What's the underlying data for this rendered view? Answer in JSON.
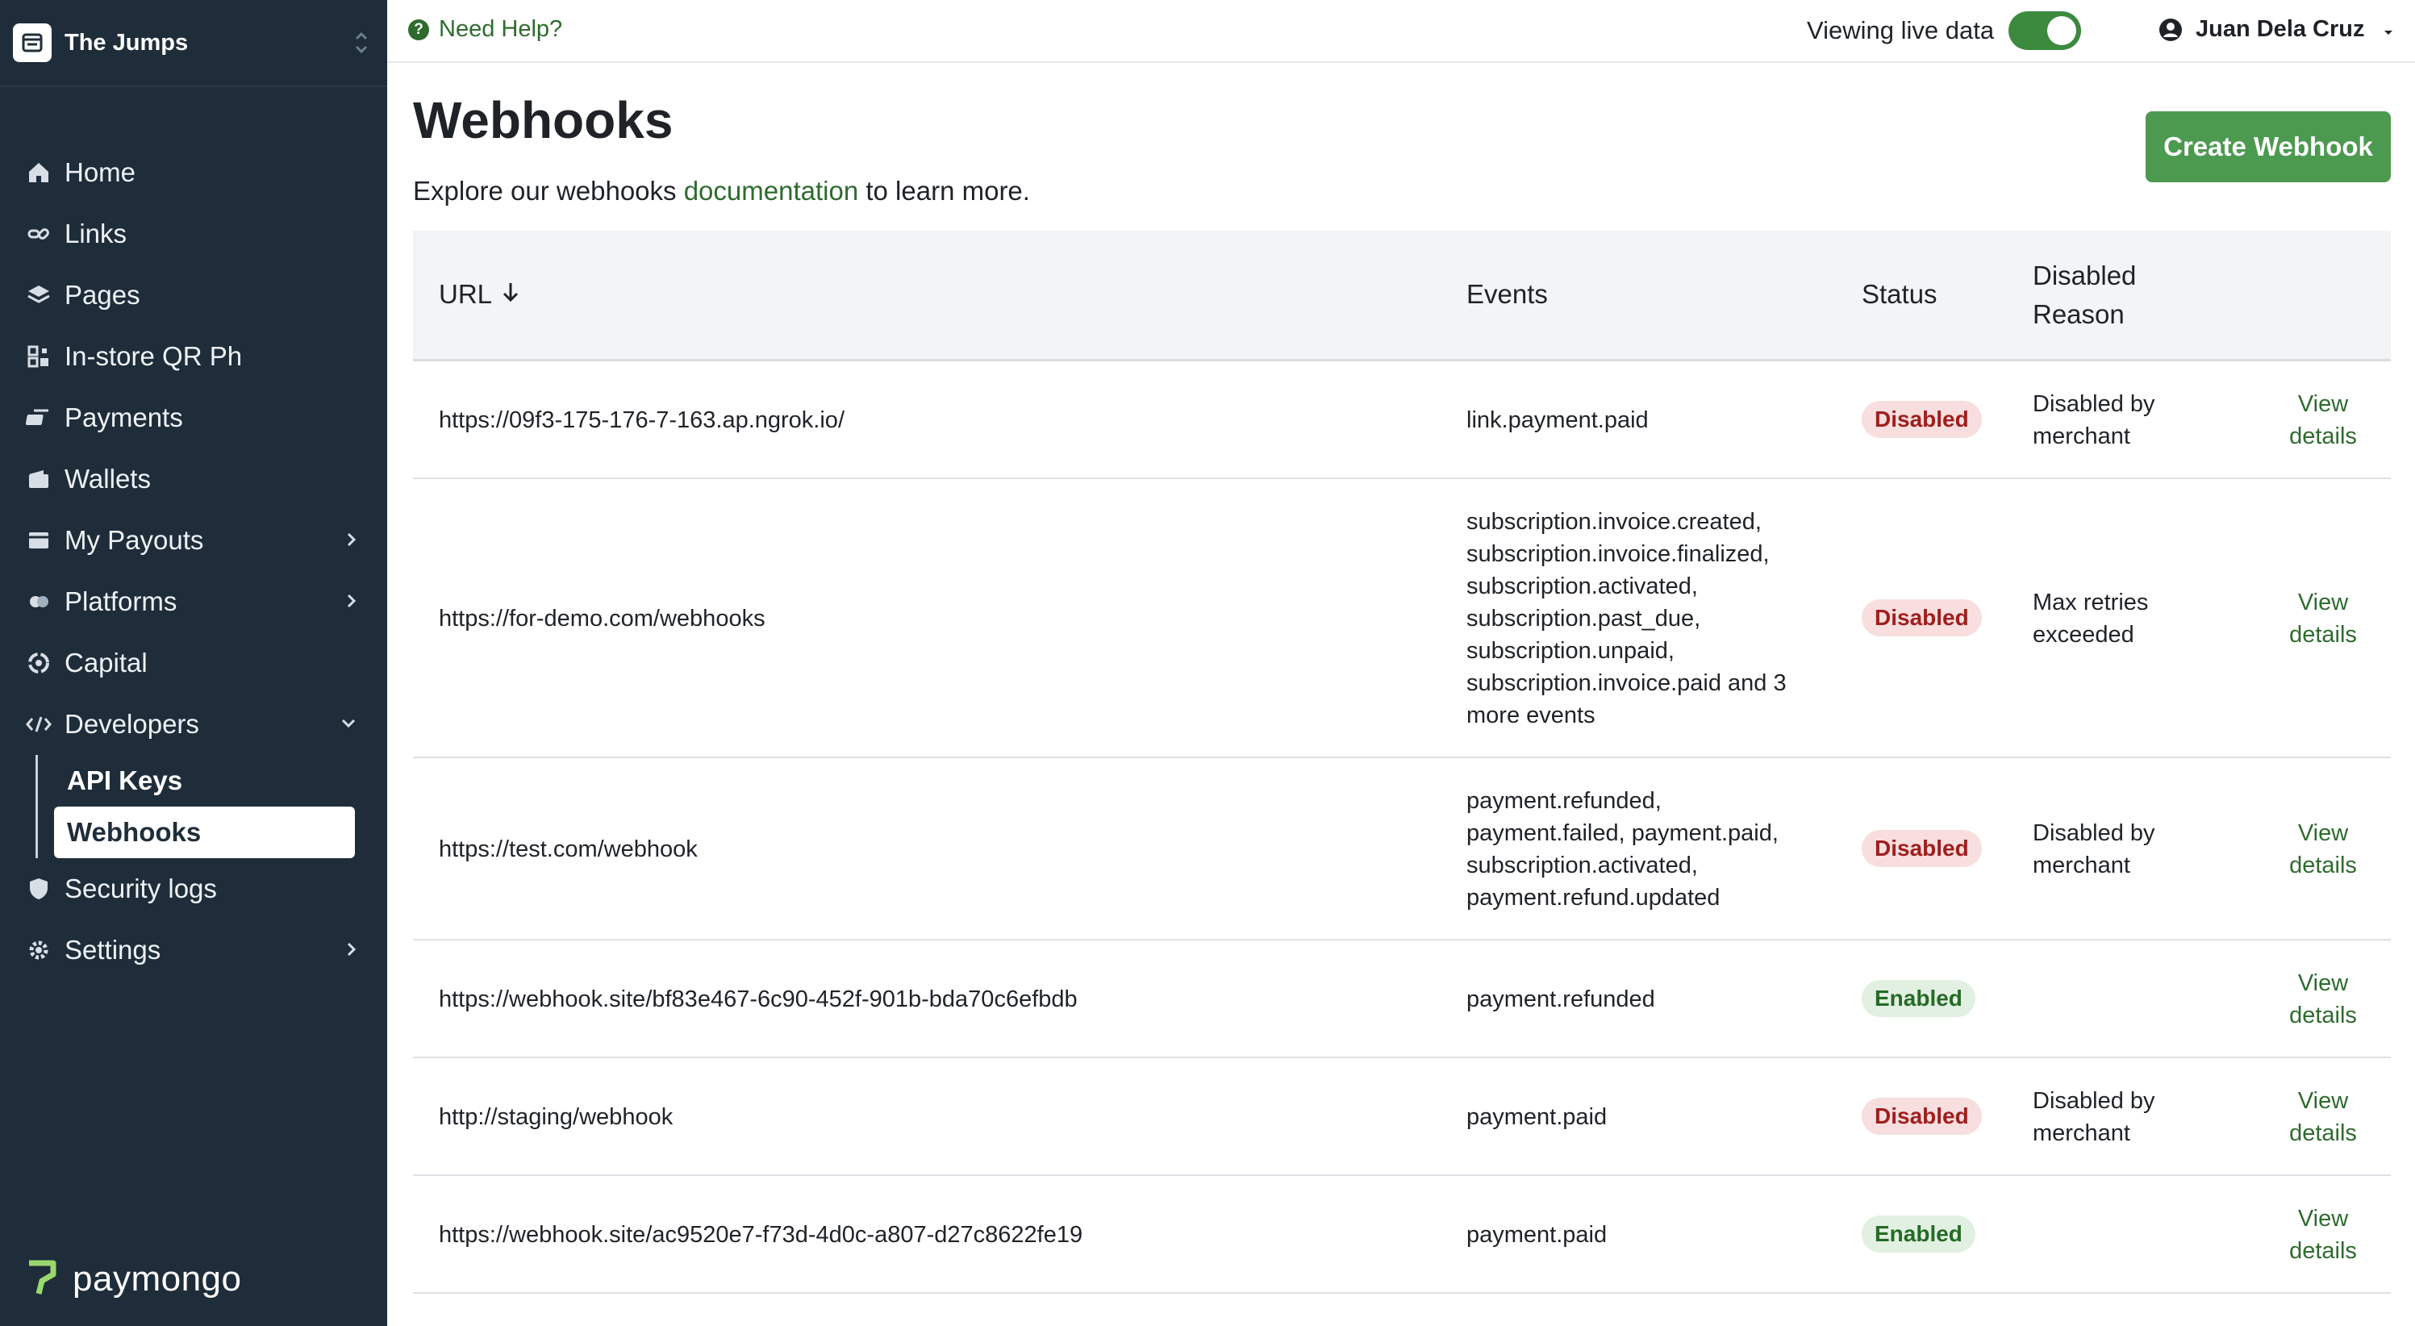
{
  "org": {
    "name": "The Jumps"
  },
  "sidebar": {
    "items": [
      {
        "label": "Home",
        "icon": "home-icon"
      },
      {
        "label": "Links",
        "icon": "links-icon"
      },
      {
        "label": "Pages",
        "icon": "pages-icon"
      },
      {
        "label": "In-store QR Ph",
        "icon": "qr-icon"
      },
      {
        "label": "Payments",
        "icon": "payments-icon"
      },
      {
        "label": "Wallets",
        "icon": "wallet-icon"
      },
      {
        "label": "My Payouts",
        "icon": "payouts-icon"
      },
      {
        "label": "Platforms",
        "icon": "platforms-icon"
      },
      {
        "label": "Capital",
        "icon": "capital-icon"
      },
      {
        "label": "Developers",
        "icon": "code-icon"
      },
      {
        "label": "Security logs",
        "icon": "shield-icon"
      },
      {
        "label": "Settings",
        "icon": "gear-icon"
      }
    ],
    "developers_sub": [
      {
        "label": "API Keys"
      },
      {
        "label": "Webhooks",
        "active": true
      }
    ]
  },
  "brand": {
    "name": "paymongo"
  },
  "topbar": {
    "help_label": "Need Help?",
    "live_label": "Viewing live data",
    "live_on": true,
    "user_name": "Juan Dela Cruz"
  },
  "page": {
    "title": "Webhooks",
    "intro_before": "Explore our webhooks",
    "intro_link": "documentation",
    "intro_after": "to learn more.",
    "create_label": "Create Webhook"
  },
  "table": {
    "columns": {
      "url": "URL",
      "events": "Events",
      "status": "Status",
      "reason_line1": "Disabled",
      "reason_line2": "Reason"
    },
    "rows": [
      {
        "url": "https://09f3-175-176-7-163.ap.ngrok.io/",
        "events": [
          "link.payment.paid"
        ],
        "status": "Disabled",
        "reason": [
          "Disabled by",
          "merchant"
        ],
        "view": [
          "View",
          "details"
        ]
      },
      {
        "url": "https://for-demo.com/webhooks",
        "events": [
          "subscription.invoice.created,",
          "subscription.invoice.finalized,",
          "subscription.activated,",
          "subscription.past_due,",
          "subscription.unpaid,",
          "subscription.invoice.paid and 3",
          "more events"
        ],
        "status": "Disabled",
        "reason": [
          "Max retries",
          "exceeded"
        ],
        "view": [
          "View",
          "details"
        ]
      },
      {
        "url": "https://test.com/webhook",
        "events": [
          "payment.refunded,",
          "payment.failed, payment.paid,",
          "subscription.activated,",
          "payment.refund.updated"
        ],
        "status": "Disabled",
        "reason": [
          "Disabled by",
          "merchant"
        ],
        "view": [
          "View",
          "details"
        ]
      },
      {
        "url": "https://webhook.site/bf83e467-6c90-452f-901b-bda70c6efbdb",
        "events": [
          "payment.refunded"
        ],
        "status": "Enabled",
        "reason": [
          "",
          ""
        ],
        "view": [
          "View",
          "details"
        ]
      },
      {
        "url": "http://staging/webhook",
        "events": [
          "payment.paid"
        ],
        "status": "Disabled",
        "reason": [
          "Disabled by",
          "merchant"
        ],
        "view": [
          "View",
          "details"
        ]
      },
      {
        "url": "https://webhook.site/ac9520e7-f73d-4d0c-a807-d27c8622fe19",
        "events": [
          "payment.paid"
        ],
        "status": "Enabled",
        "reason": [
          "",
          ""
        ],
        "view": [
          "View",
          "details"
        ]
      }
    ]
  },
  "colors": {
    "sidebar_bg": "#1f2d3a",
    "accent_green": "#4c9a50",
    "link_green": "#2e6b2e",
    "disabled_badge": "#f8dede",
    "enabled_badge": "#e2f0e1"
  }
}
